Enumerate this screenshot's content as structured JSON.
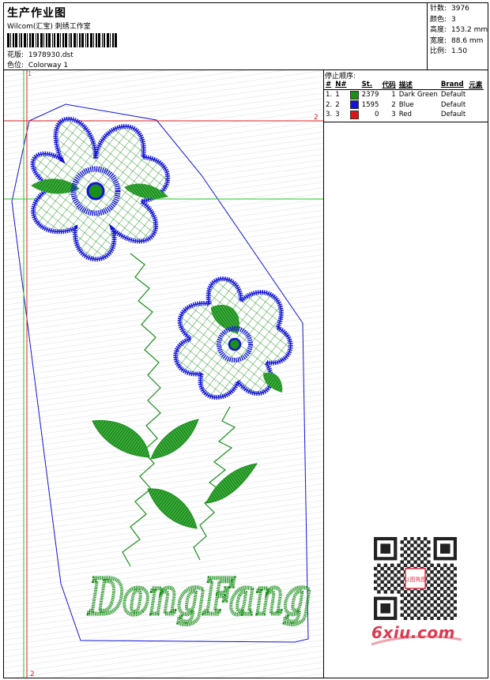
{
  "header": {
    "title": "生产作业图",
    "subtitle": "Wilcom(汇宝) 刺绣工作室",
    "design_file": {
      "label": "花版:",
      "value": "1978930.dst"
    },
    "colorway": {
      "label": "色位:",
      "value": "Colorway 1"
    },
    "stats": [
      {
        "label": "针数:",
        "value": "3976"
      },
      {
        "label": "颜色:",
        "value": "3"
      },
      {
        "label": "高度:",
        "value": "153.2 mm"
      },
      {
        "label": "宽度:",
        "value": "88.6 mm"
      },
      {
        "label": "比例:",
        "value": "1.50"
      }
    ]
  },
  "design": {
    "markers": {
      "top_v1": "1",
      "right_h": "2",
      "bottom_v2": "2"
    },
    "lettering": "DongFang"
  },
  "stop_sequence": {
    "title": "停止顺序:",
    "columns": [
      "#",
      "N#",
      "St.",
      "代码",
      "描述",
      "Brand",
      "元素"
    ],
    "rows": [
      {
        "no": "1.",
        "needle": "1",
        "color": "#1a8f1a",
        "stitches": "2379",
        "code": "1",
        "desc": "Dark Green",
        "brand": "Default",
        "element": ""
      },
      {
        "no": "2.",
        "needle": "2",
        "color": "#1414d8",
        "stitches": "1595",
        "code": "2",
        "desc": "Blue",
        "brand": "Default",
        "element": ""
      },
      {
        "no": "3.",
        "needle": "3",
        "color": "#e01414",
        "stitches": "0",
        "code": "3",
        "desc": "Red",
        "brand": "Default",
        "element": ""
      }
    ]
  },
  "watermark": {
    "text": "6xiu.com",
    "seal": "以图购图"
  },
  "colors": {
    "green": "#1a8f1a",
    "blue": "#1414d8",
    "red": "#e01414",
    "guide_green": "#22cc22",
    "guide_red": "#dd2222"
  }
}
